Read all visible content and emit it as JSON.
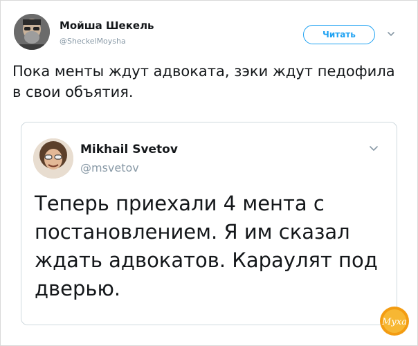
{
  "tweet": {
    "author_name": "Мойша Шекель",
    "author_handle": "@SheckelMoysha",
    "follow_label": "Читать",
    "text": "Пока менты ждут адвоката, зэки ждут педофила в свои объятия."
  },
  "quoted_tweet": {
    "author_name": "Mikhail Svetov",
    "author_handle": "@msvetov",
    "text": "Теперь приехали 4 мента с постановлением. Я им сказал ждать адвокатов. Караулят под дверью."
  },
  "watermark": {
    "text": "Муха"
  },
  "colors": {
    "accent": "#1da1f2",
    "text": "#14171a",
    "muted": "#8899a6",
    "border": "#cfd9de",
    "watermark_orange": "#f5a623"
  },
  "icons": {
    "caret": "chevron-down-icon"
  }
}
